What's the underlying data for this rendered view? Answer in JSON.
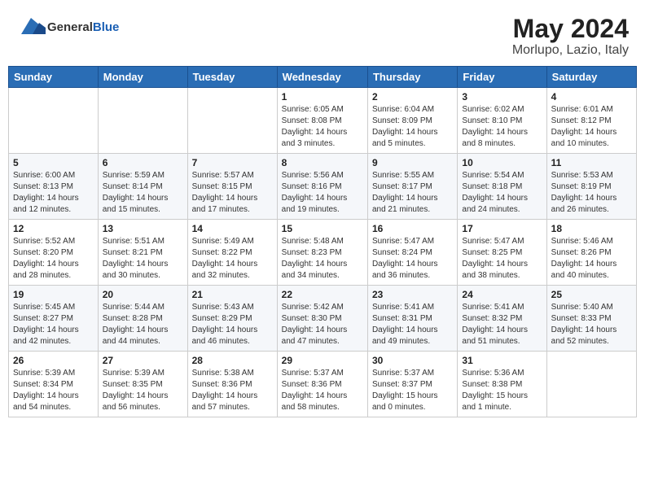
{
  "header": {
    "logo": {
      "general": "General",
      "blue": "Blue"
    },
    "title": "May 2024",
    "location": "Morlupo, Lazio, Italy"
  },
  "weekdays": [
    "Sunday",
    "Monday",
    "Tuesday",
    "Wednesday",
    "Thursday",
    "Friday",
    "Saturday"
  ],
  "weeks": [
    [
      {
        "day": "",
        "info": ""
      },
      {
        "day": "",
        "info": ""
      },
      {
        "day": "",
        "info": ""
      },
      {
        "day": "1",
        "info": "Sunrise: 6:05 AM\nSunset: 8:08 PM\nDaylight: 14 hours\nand 3 minutes."
      },
      {
        "day": "2",
        "info": "Sunrise: 6:04 AM\nSunset: 8:09 PM\nDaylight: 14 hours\nand 5 minutes."
      },
      {
        "day": "3",
        "info": "Sunrise: 6:02 AM\nSunset: 8:10 PM\nDaylight: 14 hours\nand 8 minutes."
      },
      {
        "day": "4",
        "info": "Sunrise: 6:01 AM\nSunset: 8:12 PM\nDaylight: 14 hours\nand 10 minutes."
      }
    ],
    [
      {
        "day": "5",
        "info": "Sunrise: 6:00 AM\nSunset: 8:13 PM\nDaylight: 14 hours\nand 12 minutes."
      },
      {
        "day": "6",
        "info": "Sunrise: 5:59 AM\nSunset: 8:14 PM\nDaylight: 14 hours\nand 15 minutes."
      },
      {
        "day": "7",
        "info": "Sunrise: 5:57 AM\nSunset: 8:15 PM\nDaylight: 14 hours\nand 17 minutes."
      },
      {
        "day": "8",
        "info": "Sunrise: 5:56 AM\nSunset: 8:16 PM\nDaylight: 14 hours\nand 19 minutes."
      },
      {
        "day": "9",
        "info": "Sunrise: 5:55 AM\nSunset: 8:17 PM\nDaylight: 14 hours\nand 21 minutes."
      },
      {
        "day": "10",
        "info": "Sunrise: 5:54 AM\nSunset: 8:18 PM\nDaylight: 14 hours\nand 24 minutes."
      },
      {
        "day": "11",
        "info": "Sunrise: 5:53 AM\nSunset: 8:19 PM\nDaylight: 14 hours\nand 26 minutes."
      }
    ],
    [
      {
        "day": "12",
        "info": "Sunrise: 5:52 AM\nSunset: 8:20 PM\nDaylight: 14 hours\nand 28 minutes."
      },
      {
        "day": "13",
        "info": "Sunrise: 5:51 AM\nSunset: 8:21 PM\nDaylight: 14 hours\nand 30 minutes."
      },
      {
        "day": "14",
        "info": "Sunrise: 5:49 AM\nSunset: 8:22 PM\nDaylight: 14 hours\nand 32 minutes."
      },
      {
        "day": "15",
        "info": "Sunrise: 5:48 AM\nSunset: 8:23 PM\nDaylight: 14 hours\nand 34 minutes."
      },
      {
        "day": "16",
        "info": "Sunrise: 5:47 AM\nSunset: 8:24 PM\nDaylight: 14 hours\nand 36 minutes."
      },
      {
        "day": "17",
        "info": "Sunrise: 5:47 AM\nSunset: 8:25 PM\nDaylight: 14 hours\nand 38 minutes."
      },
      {
        "day": "18",
        "info": "Sunrise: 5:46 AM\nSunset: 8:26 PM\nDaylight: 14 hours\nand 40 minutes."
      }
    ],
    [
      {
        "day": "19",
        "info": "Sunrise: 5:45 AM\nSunset: 8:27 PM\nDaylight: 14 hours\nand 42 minutes."
      },
      {
        "day": "20",
        "info": "Sunrise: 5:44 AM\nSunset: 8:28 PM\nDaylight: 14 hours\nand 44 minutes."
      },
      {
        "day": "21",
        "info": "Sunrise: 5:43 AM\nSunset: 8:29 PM\nDaylight: 14 hours\nand 46 minutes."
      },
      {
        "day": "22",
        "info": "Sunrise: 5:42 AM\nSunset: 8:30 PM\nDaylight: 14 hours\nand 47 minutes."
      },
      {
        "day": "23",
        "info": "Sunrise: 5:41 AM\nSunset: 8:31 PM\nDaylight: 14 hours\nand 49 minutes."
      },
      {
        "day": "24",
        "info": "Sunrise: 5:41 AM\nSunset: 8:32 PM\nDaylight: 14 hours\nand 51 minutes."
      },
      {
        "day": "25",
        "info": "Sunrise: 5:40 AM\nSunset: 8:33 PM\nDaylight: 14 hours\nand 52 minutes."
      }
    ],
    [
      {
        "day": "26",
        "info": "Sunrise: 5:39 AM\nSunset: 8:34 PM\nDaylight: 14 hours\nand 54 minutes."
      },
      {
        "day": "27",
        "info": "Sunrise: 5:39 AM\nSunset: 8:35 PM\nDaylight: 14 hours\nand 56 minutes."
      },
      {
        "day": "28",
        "info": "Sunrise: 5:38 AM\nSunset: 8:36 PM\nDaylight: 14 hours\nand 57 minutes."
      },
      {
        "day": "29",
        "info": "Sunrise: 5:37 AM\nSunset: 8:36 PM\nDaylight: 14 hours\nand 58 minutes."
      },
      {
        "day": "30",
        "info": "Sunrise: 5:37 AM\nSunset: 8:37 PM\nDaylight: 15 hours\nand 0 minutes."
      },
      {
        "day": "31",
        "info": "Sunrise: 5:36 AM\nSunset: 8:38 PM\nDaylight: 15 hours\nand 1 minute."
      },
      {
        "day": "",
        "info": ""
      }
    ]
  ]
}
